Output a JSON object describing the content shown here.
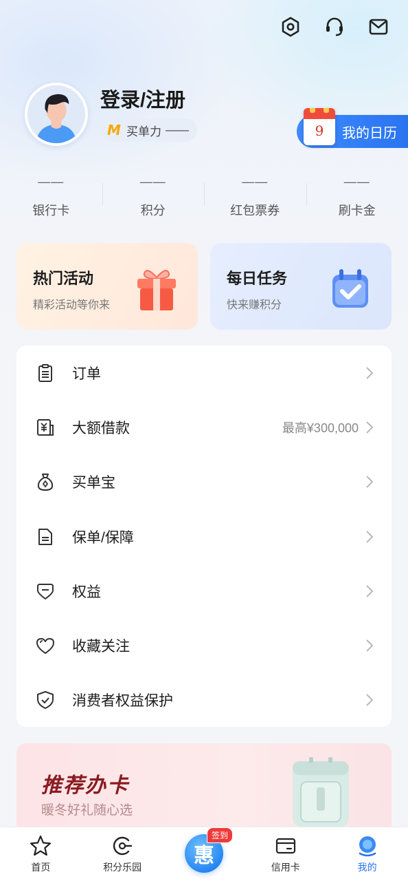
{
  "header": {
    "icons": [
      "settings-icon",
      "customer-service-icon",
      "message-icon"
    ]
  },
  "profile": {
    "login_label": "登录/注册",
    "power_label": "买单力",
    "power_value": "——"
  },
  "calendar": {
    "day": "9",
    "label": "我的日历"
  },
  "stats": [
    {
      "value": "——",
      "label": "银行卡"
    },
    {
      "value": "——",
      "label": "积分"
    },
    {
      "value": "——",
      "label": "红包票券"
    },
    {
      "value": "——",
      "label": "刷卡金"
    }
  ],
  "promos": {
    "hot": {
      "title": "热门活动",
      "subtitle": "精彩活动等你来"
    },
    "task": {
      "title": "每日任务",
      "subtitle": "快来赚积分"
    }
  },
  "menu": [
    {
      "label": "订单",
      "icon": "clipboard-icon",
      "extra": ""
    },
    {
      "label": "大额借款",
      "icon": "loan-icon",
      "extra": "最高¥300,000"
    },
    {
      "label": "买单宝",
      "icon": "money-bag-icon",
      "extra": ""
    },
    {
      "label": "保单/保障",
      "icon": "document-icon",
      "extra": ""
    },
    {
      "label": "权益",
      "icon": "benefit-icon",
      "extra": ""
    },
    {
      "label": "收藏关注",
      "icon": "heart-icon",
      "extra": ""
    },
    {
      "label": "消费者权益保护",
      "icon": "shield-icon",
      "extra": ""
    }
  ],
  "banner": {
    "title": "推荐办卡",
    "subtitle": "暖冬好礼随心选"
  },
  "tabbar": {
    "home": "首页",
    "points_park": "积分乐园",
    "center_badge": "签到",
    "center_glyph": "惠",
    "credit_card": "信用卡",
    "mine": "我的"
  },
  "colors": {
    "accent": "#2a74f0",
    "banner_title": "#8a1a20"
  }
}
